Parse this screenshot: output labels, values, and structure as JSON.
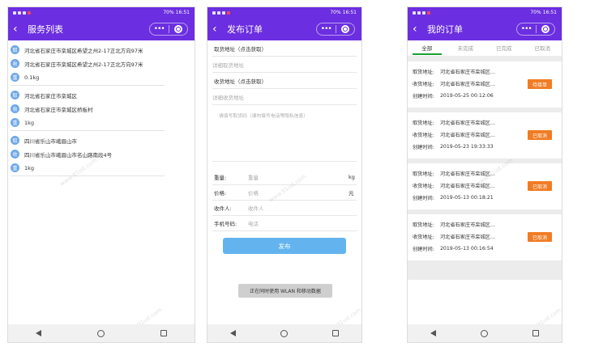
{
  "status_bar": {
    "left": "⁴ᴳ ᵢₗ ⁴ᴳ ᵢₗ",
    "battery": "70%",
    "time": "16:51"
  },
  "screen1": {
    "title": "服务列表",
    "groups": [
      {
        "rows": [
          {
            "badge": "取",
            "text": "河北省石家庄市栾城区希望之州2-17正北方向97米"
          },
          {
            "badge": "收",
            "text": "河北省石家庄市栾城区希望之州2-17正北方向97米"
          },
          {
            "badge": "重",
            "text": "0.1kg"
          }
        ]
      },
      {
        "rows": [
          {
            "badge": "取",
            "text": "河北省石家庄市栾城区"
          },
          {
            "badge": "收",
            "text": "河北省石家庄市栾城区桥板村"
          },
          {
            "badge": "重",
            "text": "1kg"
          }
        ]
      },
      {
        "rows": [
          {
            "badge": "取",
            "text": "四川省乐山市峨眉山市"
          },
          {
            "badge": "收",
            "text": "四川省乐山市峨眉山市名山路南段4号"
          },
          {
            "badge": "重",
            "text": "1kg"
          }
        ]
      }
    ]
  },
  "screen2": {
    "title": "发布订单",
    "pickup_label": "取货地址（点击获取）",
    "pickup_detail_placeholder": "详细取货地址",
    "delivery_label": "收货地址（点击获取）",
    "delivery_detail_placeholder": "详细收货地址",
    "note_placeholder": "请填写取货码（请勿填写电话等隐私信息）",
    "weight_label": "重量:",
    "weight_placeholder": "重量",
    "weight_unit": "kg",
    "price_label": "价格:",
    "price_placeholder": "价格",
    "price_unit": "元",
    "receiver_label": "收件人:",
    "receiver_placeholder": "收件人",
    "phone_label": "手机号码:",
    "phone_placeholder": "电话",
    "publish_button": "发布",
    "toast": "正在同时使用 WLAN 和移动数据"
  },
  "screen3": {
    "title": "我的订单",
    "tabs": [
      "全部",
      "未完成",
      "已完成",
      "已取消"
    ],
    "active_tab": "全部",
    "labels": {
      "pickup": "取货地址:",
      "delivery": "收货地址:",
      "created": "创建时间:"
    },
    "orders": [
      {
        "pickup": "河北省石家庄市栾城区…",
        "delivery": "河北省石家庄市栾城区…",
        "created": "2019-05-25 00:12:06",
        "status": "待接单"
      },
      {
        "pickup": "河北省石家庄市栾城区…",
        "delivery": "河北省石家庄市栾城区…",
        "created": "2019-05-23 19:33:33",
        "status": "已取消"
      },
      {
        "pickup": "河北省石家庄市栾城区…",
        "delivery": "河北省石家庄市栾城区…",
        "created": "2019-05-13 00:18:21",
        "status": "已取消"
      },
      {
        "pickup": "河北省石家庄市栾城区…",
        "delivery": "河北省石家庄市栾城区…",
        "created": "2019-05-13 00:16:54",
        "status": "已取消"
      }
    ]
  },
  "colors": {
    "header": "#6b2ee0",
    "badge": "#6fa8e8",
    "button": "#63b4ee",
    "status": "#f07c24",
    "tab_active": "#1aa033"
  },
  "watermark": "www.91ud.com"
}
